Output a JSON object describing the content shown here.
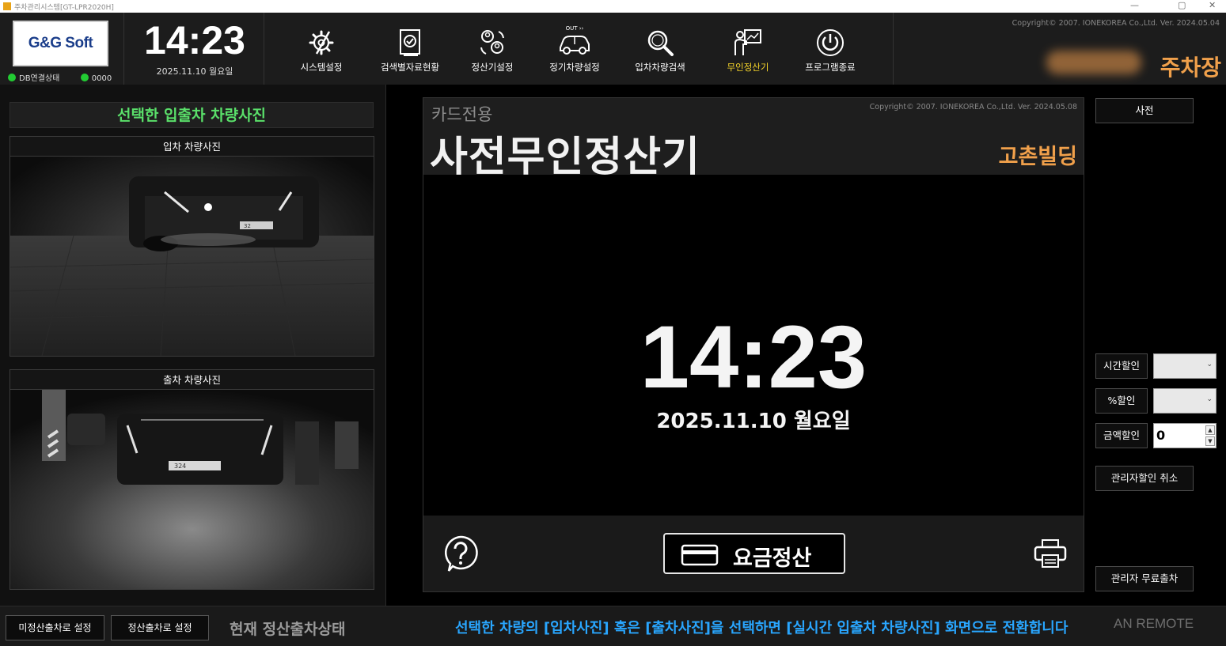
{
  "window": {
    "title": "주차관리시스템[GT-LPR2020H]",
    "minimize": "—",
    "maximize": "▢",
    "close": "✕"
  },
  "header": {
    "logo": "G&G Soft",
    "db_status_label": "DB연결상태",
    "counter": "0000",
    "time": "14:23",
    "date": "2025.11.10 월요일",
    "copyright": "Copyright© 2007. IONEKOREA Co.,Ltd.   Ver. 2024.05.04",
    "parking_name": "주차장",
    "menu": [
      {
        "label": "시스템설정",
        "icon": "tools-gear-icon"
      },
      {
        "label": "검색별자료현황",
        "icon": "search-report-icon"
      },
      {
        "label": "정산기설정",
        "icon": "users-sync-icon"
      },
      {
        "label": "정기차량설정",
        "icon": "car-out-icon",
        "badge": "OUT ›› "
      },
      {
        "label": "입차차량검색",
        "icon": "magnifier-icon"
      },
      {
        "label": "무인정산기",
        "icon": "kiosk-presenter-icon",
        "active": true
      },
      {
        "label": "프로그램종료",
        "icon": "power-icon"
      }
    ]
  },
  "left_panel": {
    "title": "선택한 입출차 차량사진",
    "entry_caption": "입차 차량사진",
    "exit_caption": "출차 차량사진",
    "plate_entry": "32",
    "plate_exit": "324"
  },
  "kiosk": {
    "subtitle": "카드전용",
    "title": "사전무인정산기",
    "copyright": "Copyright© 2007. IONEKOREA Co.,Ltd.  Ver. 2024.05.08",
    "building": "고촌빌딩",
    "time": "14:23",
    "date": "2025.11.10 월요일",
    "pay_label": "요금정산"
  },
  "right_panel": {
    "advance_button": "사전",
    "time_discount": "시간할인",
    "percent_discount": "%할인",
    "amount_discount": "금액할인",
    "amount_value": "0",
    "cancel_admin_discount": "관리자할인 취소",
    "admin_free_exit": "관리자 무료출차"
  },
  "bottom": {
    "unpaid_exit_btn": "미정산출차로 설정",
    "paid_exit_btn": "정산출차로 설정",
    "state_label": "현재 정산출차상태",
    "notice": "선택한 차량의 [입차사진] 혹은 [출차사진]을 선택하면 [실시간 입출차 차량사진] 화면으로 전환합니다",
    "watermark": "AN REMOTE"
  },
  "colors": {
    "accent_green": "#5ae06a",
    "accent_orange": "#f0a04b",
    "accent_blue": "#29a6ff",
    "active_menu": "#f5d42a"
  }
}
